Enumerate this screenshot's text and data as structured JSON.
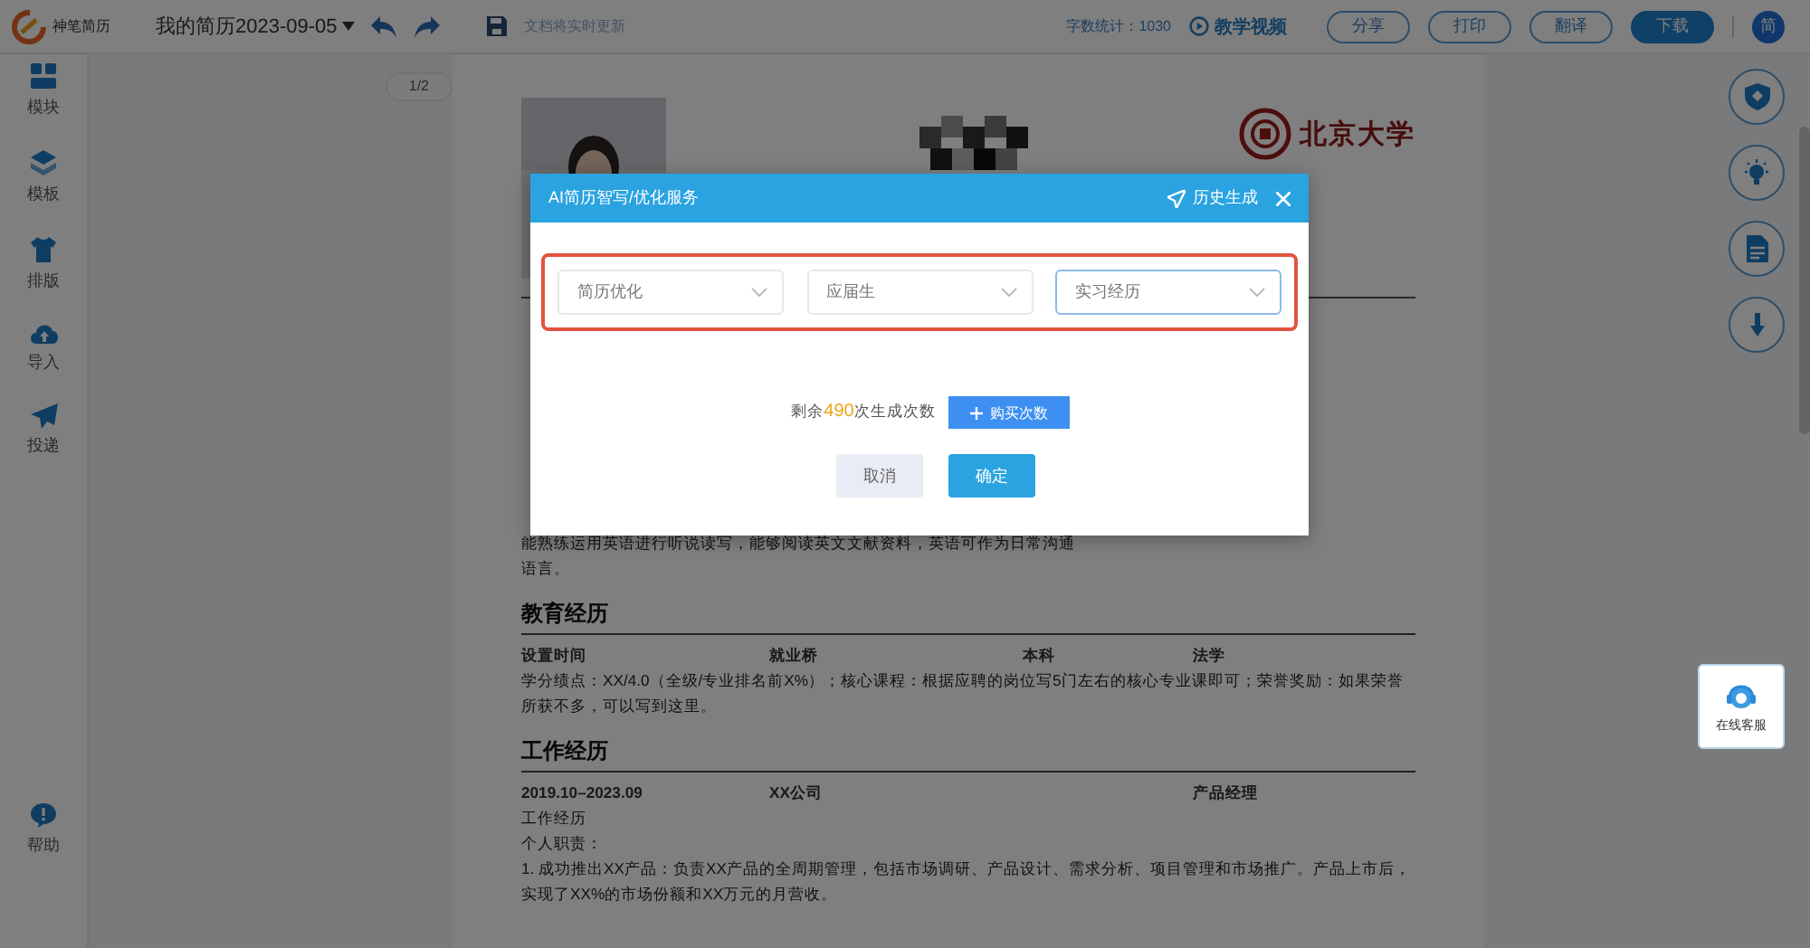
{
  "topbar": {
    "logo_text": "神笔简历",
    "doc_title": "我的简历2023-09-05",
    "save_status": "文档将实时更新",
    "word_count": "字数统计：1030",
    "tutorial": "教学视频",
    "buttons": [
      {
        "label": "分享",
        "kind": "outline"
      },
      {
        "label": "打印",
        "kind": "outline"
      },
      {
        "label": "翻译",
        "kind": "outline"
      },
      {
        "label": "下载",
        "kind": "primary"
      }
    ],
    "avatar": "简"
  },
  "sidebar": {
    "items": [
      {
        "label": "模块"
      },
      {
        "label": "模板"
      },
      {
        "label": "排版"
      },
      {
        "label": "导入"
      },
      {
        "label": "投递"
      }
    ],
    "help": {
      "label": "帮助"
    }
  },
  "page_indicator": "1/2",
  "resume": {
    "university": "北京大学",
    "intro_lines": [
      "能熟练运用英语进行听说读写，能够阅读英文文献资料，英语可作为日常沟通",
      "语言。"
    ],
    "sections": [
      {
        "title": "教育经历",
        "rows": [
          {
            "cells": [
              "设置时间",
              "就业桥",
              "本科",
              "法学"
            ],
            "lines": [
              "学分绩点：XX/4.0（全级/专业排名前X%）；核心课程：根据应聘的岗位写5门左右的核心专业课即可；荣誉奖励：如果荣誉所获不多，可以写到这里。"
            ]
          }
        ]
      },
      {
        "title": "工作经历",
        "rows": [
          {
            "cells": [
              "2019.10–2023.09",
              "XX公司",
              "",
              "产品经理"
            ],
            "lines": [
              "工作经历",
              "个人职责：",
              "1. 成功推出XX产品：负责XX产品的全周期管理，包括市场调研、产品设计、需求分析、项目管理和市场推广。产品上市后，实现了XX%的市场份额和XX万元的月营收。"
            ]
          }
        ]
      }
    ]
  },
  "dialog": {
    "title": "AI简历智写/优化服务",
    "history": "历史生成",
    "selects": [
      {
        "value": "简历优化",
        "focused": false
      },
      {
        "value": "应届生",
        "focused": false
      },
      {
        "value": "实习经历",
        "focused": true
      }
    ],
    "remaining": {
      "before": "剩余",
      "count": "490",
      "after": "次生成次数"
    },
    "buy": "购买次数",
    "cancel": "取消",
    "confirm": "确定"
  },
  "customer_service": "在线客服"
}
